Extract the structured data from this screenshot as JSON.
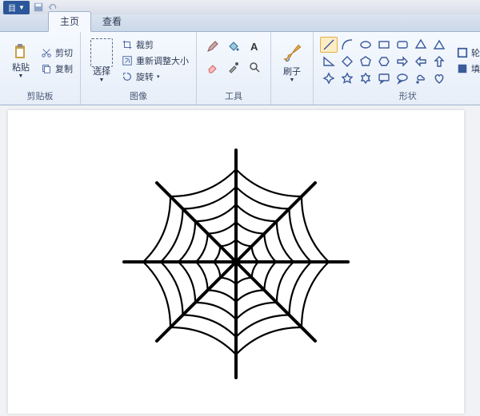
{
  "titlebar": {
    "app_menu": "目"
  },
  "tabs": {
    "home": "主页",
    "view": "查看"
  },
  "clipboard": {
    "paste": "粘贴",
    "cut": "剪切",
    "copy": "复制",
    "group_label": "剪贴板"
  },
  "image": {
    "select": "选择",
    "crop": "裁剪",
    "resize": "重新调整大小",
    "rotate": "旋转",
    "group_label": "图像"
  },
  "tools": {
    "group_label": "工具"
  },
  "brush": {
    "label": "刷子"
  },
  "shapes": {
    "outline": "轮廓",
    "fill": "填充",
    "group_label": "形状"
  },
  "canvas": {
    "content": "spider-web"
  }
}
